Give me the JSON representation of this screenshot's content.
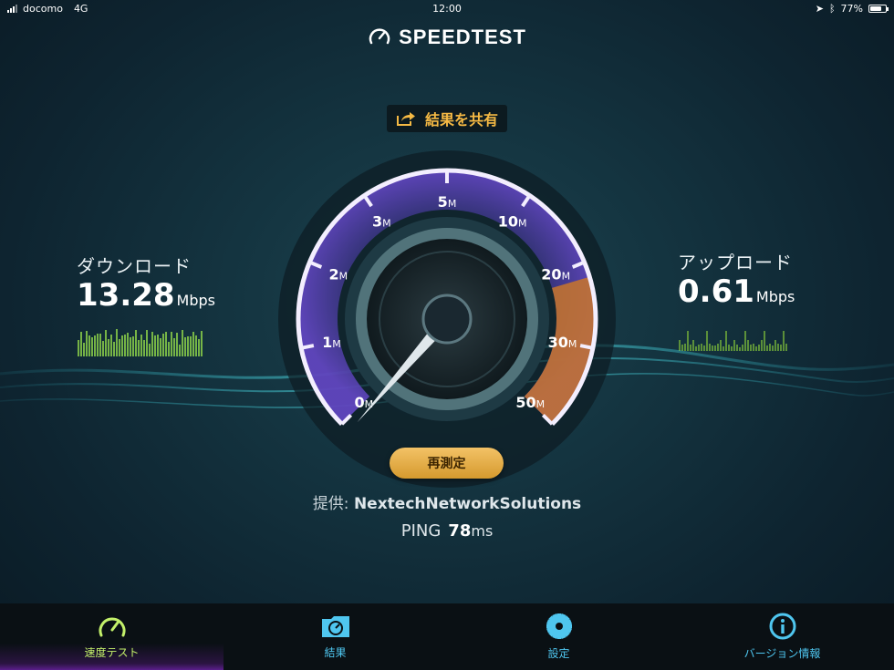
{
  "status_bar": {
    "carrier": "docomo",
    "network": "4G",
    "time": "12:00",
    "battery": "77%",
    "battery_level": 0.77
  },
  "app": {
    "title": "SPEEDTEST"
  },
  "share": {
    "label": "結果を共有"
  },
  "download": {
    "label": "ダウンロード",
    "value": "13.28",
    "unit": "Mbps"
  },
  "upload": {
    "label": "アップロード",
    "value": "0.61",
    "unit": "Mbps"
  },
  "gauge": {
    "ticks": [
      {
        "num": "0",
        "unit": "M"
      },
      {
        "num": "1",
        "unit": "M"
      },
      {
        "num": "2",
        "unit": "M"
      },
      {
        "num": "3",
        "unit": "M"
      },
      {
        "num": "5",
        "unit": "M"
      },
      {
        "num": "10",
        "unit": "M"
      },
      {
        "num": "20",
        "unit": "M"
      },
      {
        "num": "30",
        "unit": "M"
      },
      {
        "num": "50",
        "unit": "M"
      }
    ],
    "needle_value": "0"
  },
  "retest": {
    "label": "再測定"
  },
  "provider": {
    "prefix": "提供:",
    "name": "NextechNetworkSolutions"
  },
  "ping": {
    "label": "PING",
    "value": "78",
    "unit": "ms"
  },
  "tabs": [
    {
      "label": "速度テスト",
      "icon": "speedometer-icon",
      "active": true
    },
    {
      "label": "結果",
      "icon": "results-folder-icon"
    },
    {
      "label": "設定",
      "icon": "gear-icon"
    },
    {
      "label": "バージョン情報",
      "icon": "info-icon"
    }
  ],
  "colors": {
    "accent": "#f5b944",
    "tab_active": "#c3f06a",
    "tab_inactive": "#4fc6ef",
    "gauge_arc": "#7a4fd8",
    "gauge_high": "#e08a2a"
  }
}
